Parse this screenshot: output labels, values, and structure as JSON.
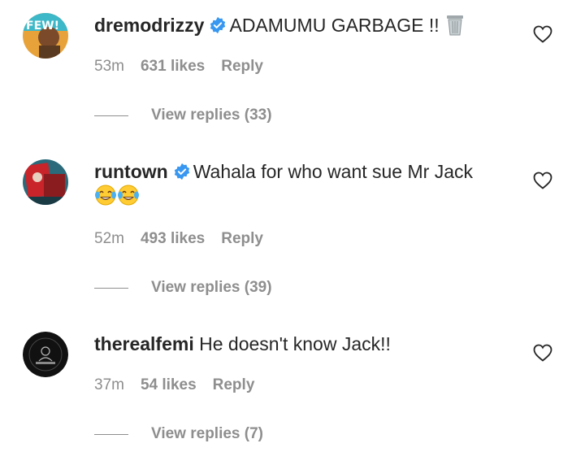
{
  "comments": [
    {
      "username": "dremodrizzy",
      "verified": true,
      "text": "ADAMUMU GARBAGE !!",
      "emoji": "wastebasket-emoji",
      "time": "53m",
      "likes": "631 likes",
      "reply": "Reply",
      "view_replies": "View replies (33)",
      "avatar_text": "FEW!"
    },
    {
      "username": "runtown",
      "verified": true,
      "text": "Wahala for who want sue Mr Jack",
      "emoji": "tears-of-joy-emoji x2",
      "time": "52m",
      "likes": "493 likes",
      "reply": "Reply",
      "view_replies": "View replies (39)"
    },
    {
      "username": "therealfemi",
      "verified": false,
      "text": "He doesn't know Jack!!",
      "time": "37m",
      "likes": "54 likes",
      "reply": "Reply",
      "view_replies": "View replies (7)"
    }
  ],
  "colors": {
    "text": "#262626",
    "secondary": "#8e8e8e",
    "verified": "#3897f0"
  }
}
